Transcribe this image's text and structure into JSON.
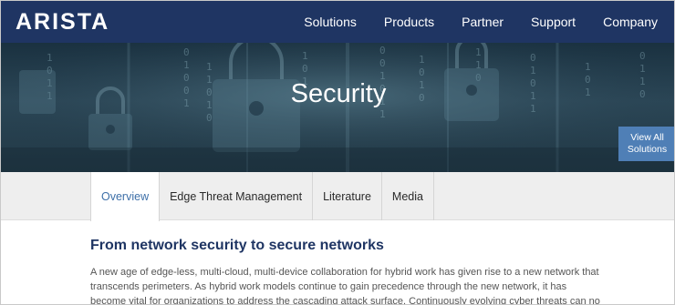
{
  "brand": {
    "logo_text": "ARISTA"
  },
  "nav": {
    "items": [
      "Solutions",
      "Products",
      "Partner",
      "Support",
      "Company"
    ]
  },
  "hero": {
    "title": "Security",
    "view_all_line1": "View All",
    "view_all_line2": "Solutions"
  },
  "tabs": [
    "Overview",
    "Edge Threat Management",
    "Literature",
    "Media"
  ],
  "active_tab": "Overview",
  "content": {
    "heading": "From network security to secure networks",
    "paragraph": "A new age of edge-less, multi-cloud, multi-device collaboration for hybrid work has given rise to a new network that transcends perimeters. As hybrid work models continue to gain precedence through the new network, it has become vital for organizations to address the cascading attack surface. Continuously evolving cyber threats can no"
  },
  "colors": {
    "header_bg": "#1f3563",
    "accent": "#3d6fa8",
    "view_all_bg": "#4f7fb6"
  }
}
